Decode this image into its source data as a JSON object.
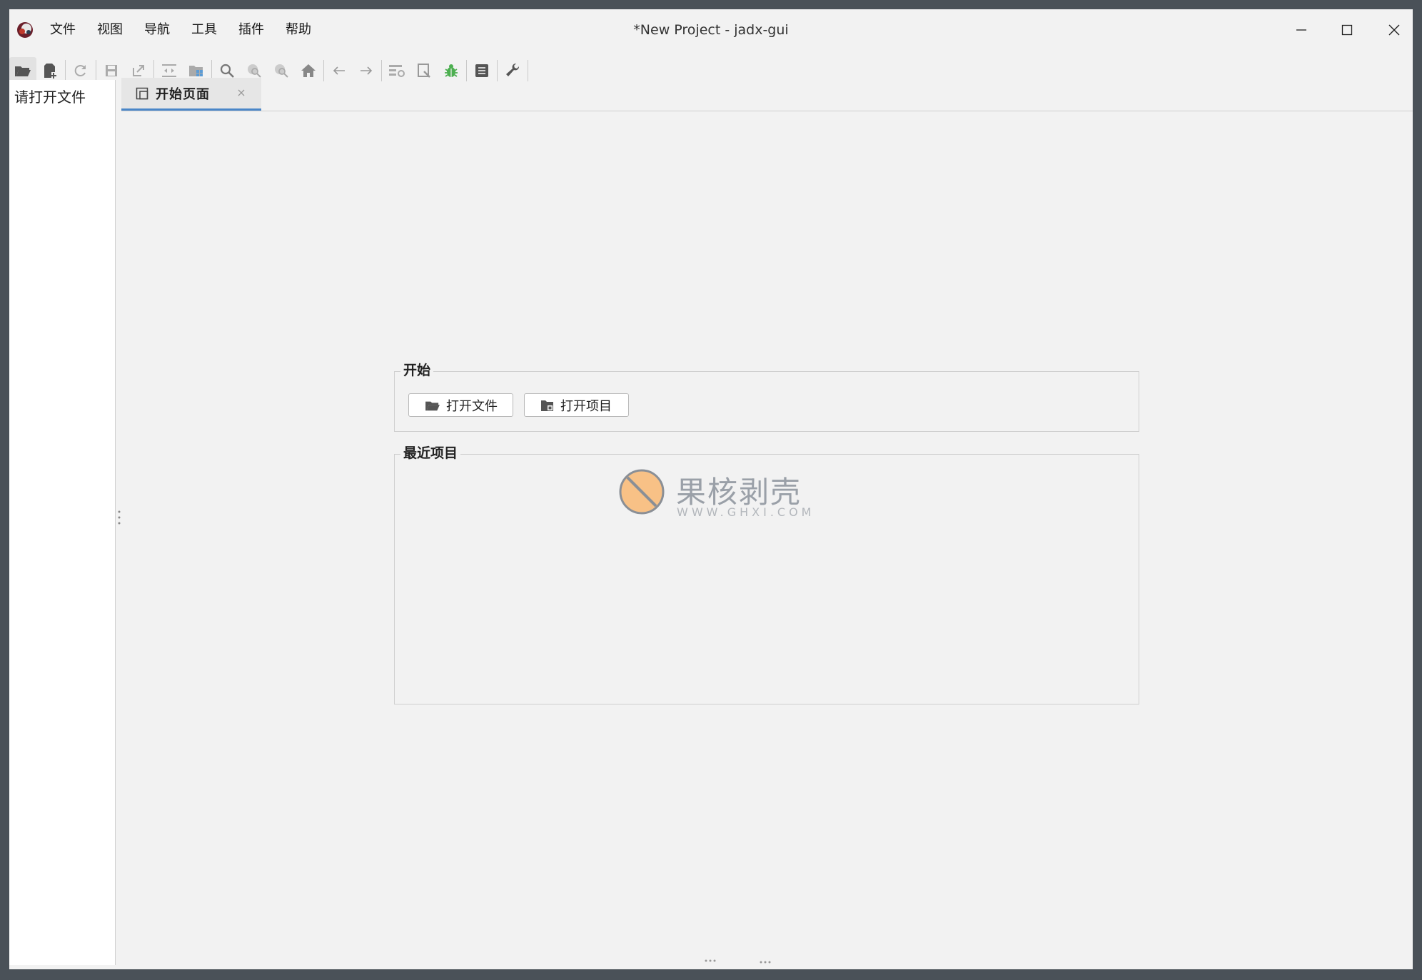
{
  "window": {
    "title": "*New Project - jadx-gui"
  },
  "menu": {
    "items": [
      "文件",
      "视图",
      "导航",
      "工具",
      "插件",
      "帮助"
    ]
  },
  "toolbar": {
    "buttons": [
      {
        "icon": "open-folder-icon",
        "enabled": true
      },
      {
        "icon": "add-files-icon",
        "enabled": true
      },
      {
        "icon": "reload-icon",
        "enabled": false
      },
      {
        "icon": "save-icon",
        "enabled": false
      },
      {
        "icon": "export-icon",
        "enabled": false
      },
      {
        "icon": "sync-with-editor-icon",
        "enabled": false
      },
      {
        "icon": "flatten-packages-icon",
        "enabled": false
      },
      {
        "icon": "search-icon",
        "enabled": false
      },
      {
        "icon": "find-class-icon",
        "enabled": false
      },
      {
        "icon": "find-usage-icon",
        "enabled": false
      },
      {
        "icon": "home-icon",
        "enabled": false
      },
      {
        "icon": "back-arrow-icon",
        "enabled": false
      },
      {
        "icon": "forward-arrow-icon",
        "enabled": false
      },
      {
        "icon": "deobfuscation-icon",
        "enabled": false
      },
      {
        "icon": "bookmark-icon",
        "enabled": false
      },
      {
        "icon": "debug-bug-icon",
        "enabled": true
      },
      {
        "icon": "log-viewer-icon",
        "enabled": true
      },
      {
        "icon": "preferences-wrench-icon",
        "enabled": true
      }
    ]
  },
  "tree": {
    "hint": "请打开文件"
  },
  "tabs": [
    {
      "label": "开始页面",
      "active": true
    }
  ],
  "start_page": {
    "start_group": {
      "title": "开始",
      "open_file_label": "打开文件",
      "open_project_label": "打开项目"
    },
    "recent_group": {
      "title": "最近项目"
    }
  },
  "watermark": {
    "name": "果核剥壳",
    "url": "WWW.GHXI.COM"
  },
  "colors": {
    "accent": "#4a86c8",
    "background": "#f2f2f2",
    "debug_green": "#4caf50"
  }
}
